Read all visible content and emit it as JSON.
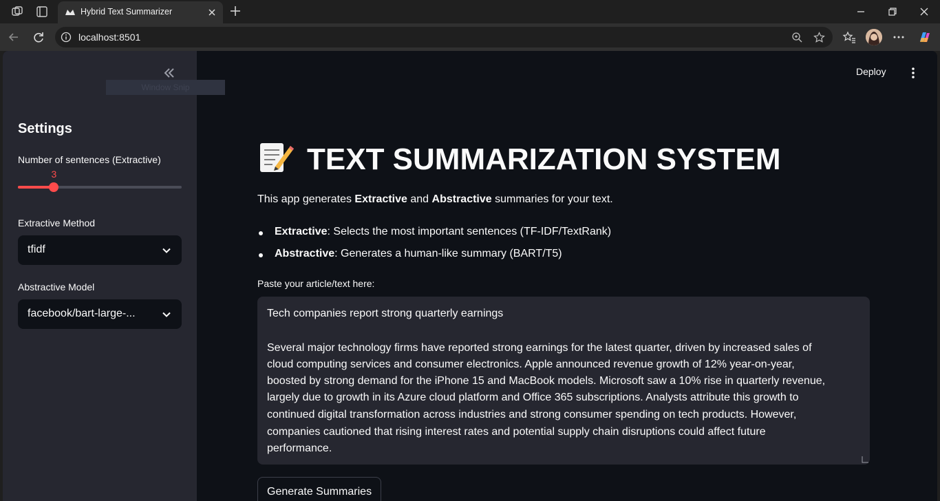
{
  "browser": {
    "tab_title": "Hybrid Text Summarizer",
    "url": "localhost:8501"
  },
  "sidebar": {
    "snip_tooltip": "Window Snip",
    "title": "Settings",
    "slider": {
      "label": "Number of sentences (Extractive)",
      "value": "3",
      "fraction": 0.22
    },
    "extractive": {
      "label": "Extractive Method",
      "value": "tfidf"
    },
    "abstractive": {
      "label": "Abstractive Model",
      "value": "facebook/bart-large-..."
    }
  },
  "header": {
    "deploy_label": "Deploy"
  },
  "main": {
    "title": "TEXT SUMMARIZATION SYSTEM",
    "intro": {
      "prefix": "This app generates ",
      "b1": "Extractive",
      "mid": " and ",
      "b2": "Abstractive",
      "suffix": " summaries for your text."
    },
    "bullets": [
      {
        "term": "Extractive",
        "desc": ": Selects the most important sentences (TF-IDF/TextRank)"
      },
      {
        "term": "Abstractive",
        "desc": ": Generates a human-like summary (BART/T5)"
      }
    ],
    "textarea_label": "Paste your article/text here:",
    "textarea_lines": [
      "Tech companies report strong quarterly earnings",
      "",
      "Several major technology firms have reported strong earnings for the latest quarter, driven by increased sales of",
      "cloud computing services and consumer electronics. Apple announced revenue growth of 12% year-on-year,",
      "boosted by strong demand for the iPhone 15 and MacBook models. Microsoft saw a 10% rise in quarterly revenue,",
      "largely due to growth in its Azure cloud platform and Office 365 subscriptions. Analysts attribute this growth to",
      "continued digital transformation across industries and strong consumer spending on tech products. However,",
      "companies cautioned that rising interest rates and potential supply chain disruptions could affect future",
      "performance."
    ],
    "button_label": "Generate Summaries"
  },
  "colors": {
    "accent": "#ff4b4b",
    "app_bg": "#0e1117",
    "sidebar_bg": "#262730"
  }
}
